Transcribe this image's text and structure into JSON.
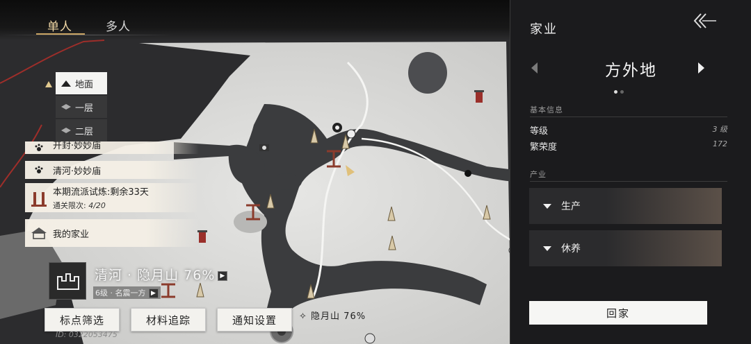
{
  "mode_tabs": [
    "单人",
    "多人"
  ],
  "floors": [
    "地面",
    "一层",
    "二层"
  ],
  "tasks": {
    "task1": "开封·妙妙庙",
    "task2": "清河·妙妙庙",
    "trial_title": "本期流派试炼:剩余33天",
    "trial_sub_label": "通关限次:",
    "trial_sub_value": "4/20",
    "home": "我的家业"
  },
  "location": {
    "title": "清河 · 隐月山 76%",
    "subtitle": "6级 · 名震一方"
  },
  "buttons": {
    "filter": "标点筛选",
    "material": "材料追踪",
    "notify": "通知设置"
  },
  "map_label": "隐月山  76%",
  "player_id": "ID: 0322053475",
  "panel": {
    "title": "家业",
    "place": "方外地",
    "section_basic": "基本信息",
    "level_label": "等级",
    "level_value": "3 级",
    "prosperity_label": "繁荣度",
    "prosperity_value": "172",
    "section_industry": "产业",
    "acc_production": "生产",
    "acc_rest": "休养",
    "home_button": "回家"
  },
  "colors": {
    "accent_gold": "#c9a463",
    "panel_bg": "#1b1b1d",
    "map_land": "#d9d9d7",
    "map_water": "#3b3c3e"
  }
}
